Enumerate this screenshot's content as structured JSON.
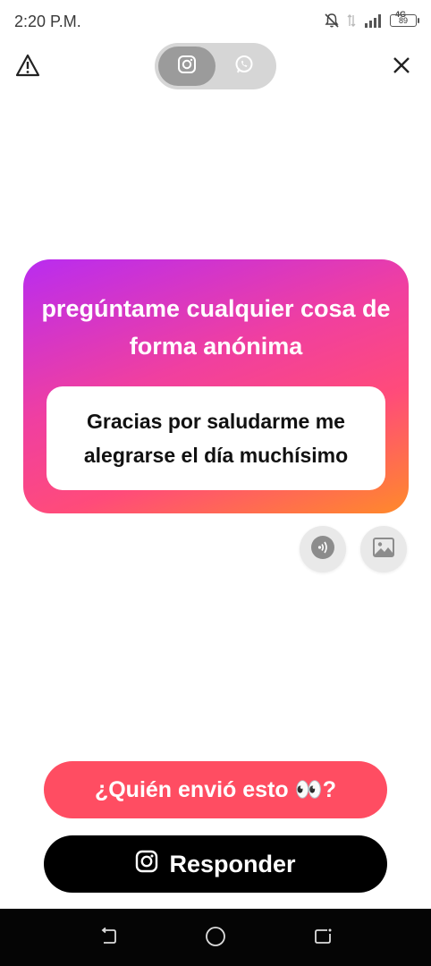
{
  "status_bar": {
    "time": "2:20 P.M.",
    "network": "4G",
    "battery": "89"
  },
  "toolbar": {
    "icons": [
      "warning-icon",
      "instagram-icon",
      "whatsapp-icon",
      "close-icon"
    ]
  },
  "card": {
    "title": "pregúntame cualquier cosa de forma anónima",
    "message": "Gracias por saludarme me alegrarse el día muchísimo",
    "gradient": [
      "#b92cf0",
      "#f03fa0",
      "#ff4b7a",
      "#ff8a2a"
    ]
  },
  "actions": {
    "who_sent_label": "¿Quién envió esto 👀?",
    "reply_label": "Responder"
  },
  "colors": {
    "accent_red": "#ff4d62",
    "reply_black": "#000000"
  }
}
